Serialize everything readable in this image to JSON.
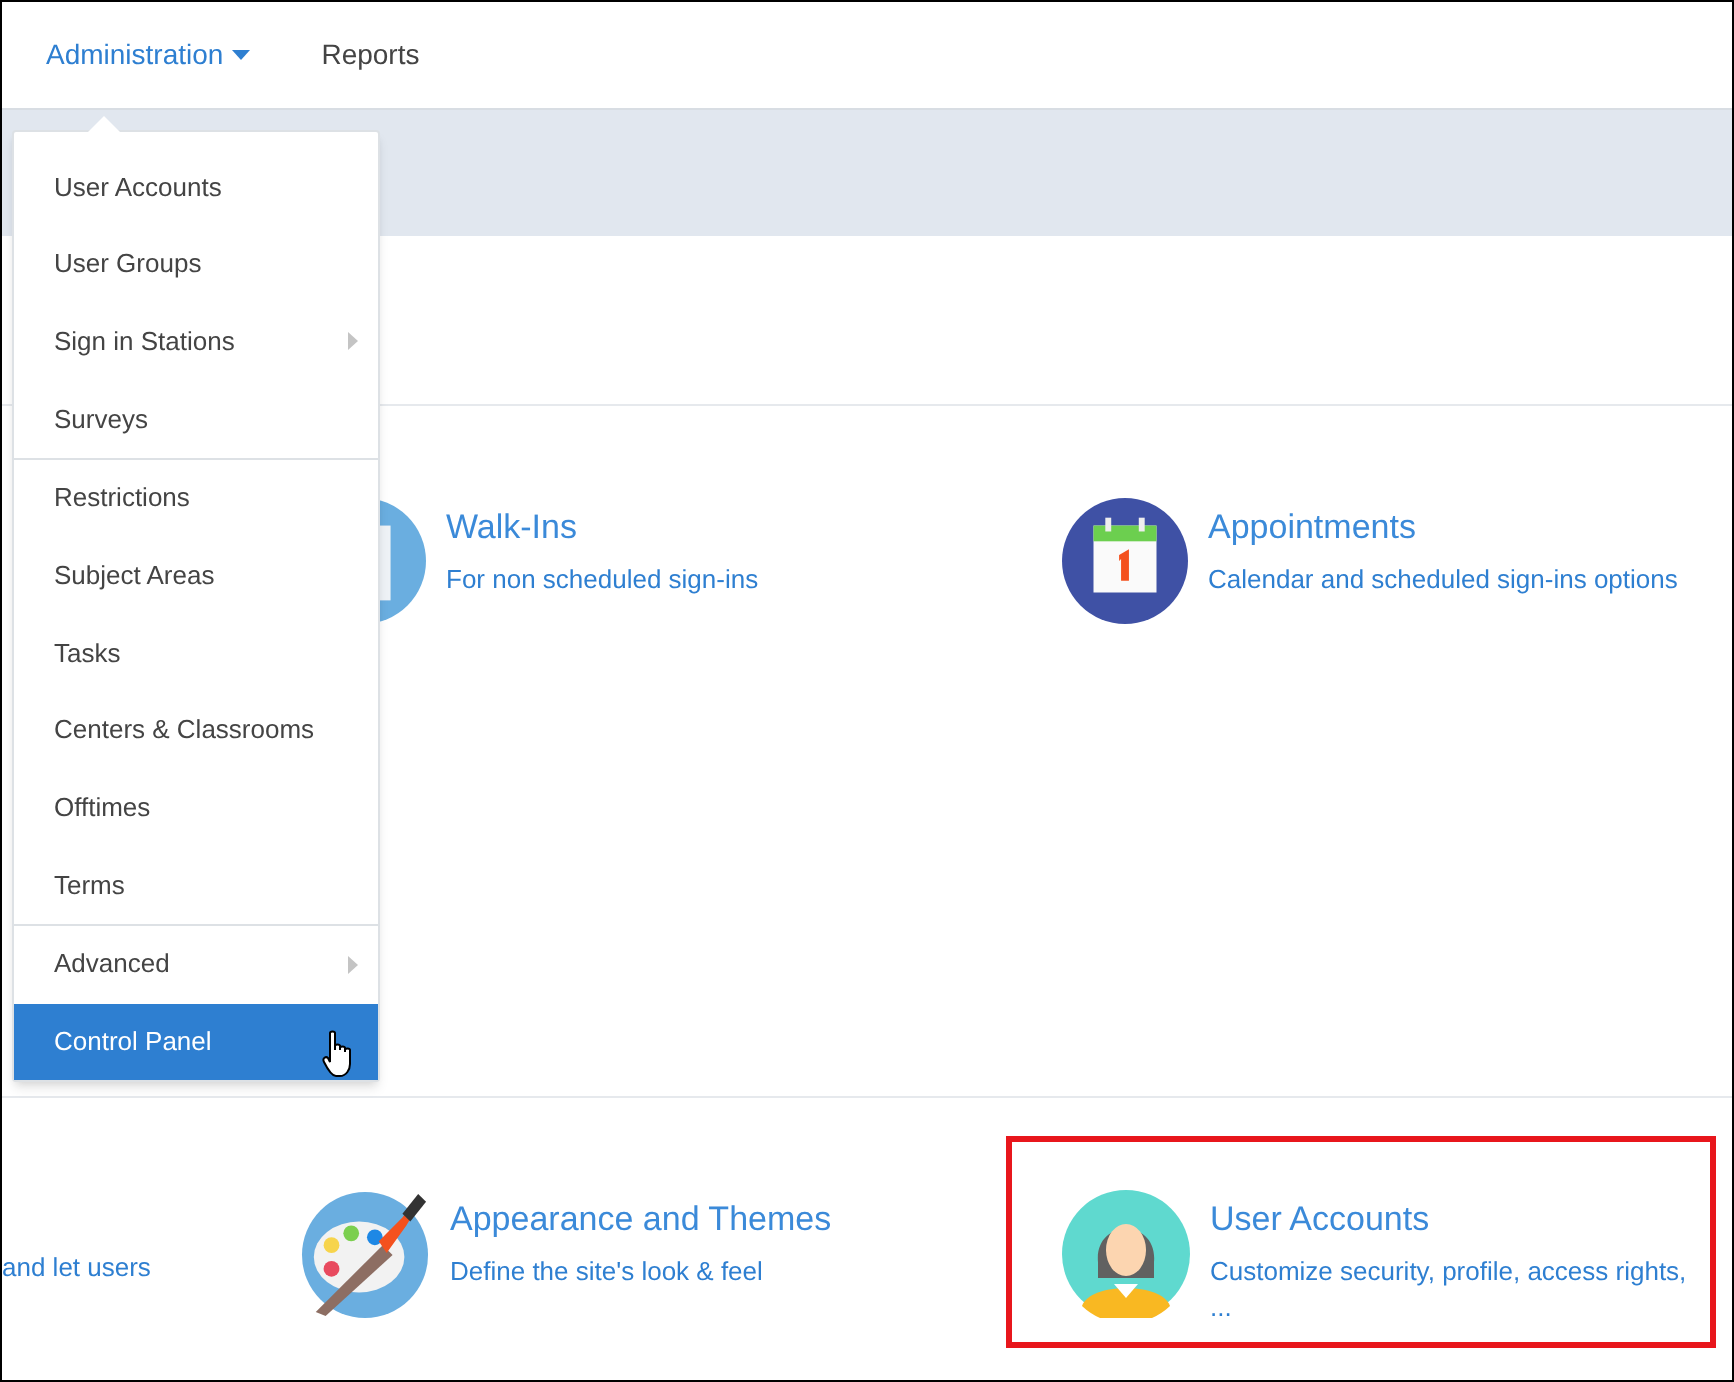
{
  "nav": {
    "items": [
      {
        "label": "Administration",
        "selected": true,
        "expanded": true
      },
      {
        "label": "Reports",
        "selected": false,
        "expanded": false
      }
    ]
  },
  "menu": {
    "groups": [
      [
        {
          "label": "User Accounts",
          "selected": false,
          "submenu": false
        },
        {
          "label": "User Groups",
          "selected": false,
          "submenu": false
        },
        {
          "label": "Sign in Stations",
          "selected": false,
          "submenu": true
        },
        {
          "label": "Surveys",
          "selected": false,
          "submenu": false
        }
      ],
      [
        {
          "label": "Restrictions",
          "selected": false,
          "submenu": false
        },
        {
          "label": "Subject Areas",
          "selected": false,
          "submenu": false
        },
        {
          "label": "Tasks",
          "selected": false,
          "submenu": false
        },
        {
          "label": "Centers & Classrooms",
          "selected": false,
          "submenu": false
        },
        {
          "label": "Offtimes",
          "selected": false,
          "submenu": false
        },
        {
          "label": "Terms",
          "selected": false,
          "submenu": false
        }
      ],
      [
        {
          "label": "Advanced",
          "selected": false,
          "submenu": true
        },
        {
          "label": "Control Panel",
          "selected": true,
          "submenu": false
        }
      ]
    ]
  },
  "sections": [
    {
      "cards": [
        {
          "kind": "walkin",
          "title": "Walk-Ins",
          "description": "For non scheduled sign-ins",
          "highlighted": false
        },
        {
          "kind": "calendar",
          "title": "Appointments",
          "description": "Calendar and scheduled sign-ins options",
          "highlighted": false
        }
      ]
    },
    {
      "partial_text": "and let users",
      "cards": [
        {
          "kind": "palette",
          "title": "Appearance and Themes",
          "description": "Define the site's look & feel",
          "highlighted": false
        },
        {
          "kind": "person",
          "title": "User Accounts",
          "description": "Customize security, profile, access rights, ...",
          "highlighted": true
        }
      ]
    }
  ]
}
